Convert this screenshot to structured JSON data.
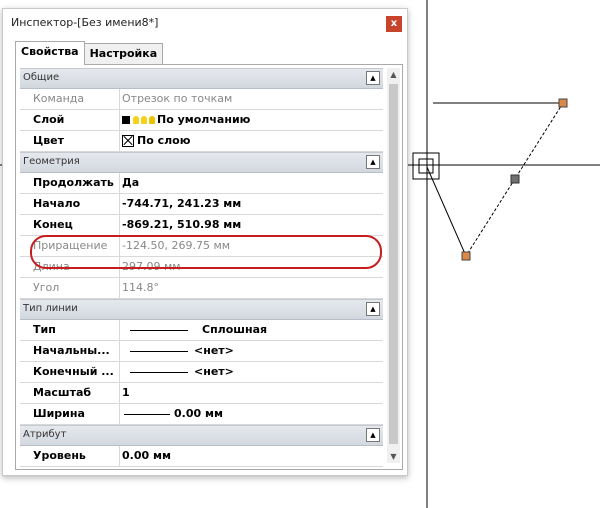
{
  "window": {
    "title": "Инспектор-[Без имени8*]",
    "close_symbol": "x"
  },
  "tabs": [
    {
      "label": "Свойства",
      "active": true
    },
    {
      "label": "Настройка",
      "active": false
    }
  ],
  "categories": {
    "general": "Общие",
    "geometry": "Геометрия",
    "linetype": "Тип линии",
    "attribute": "Атрибут"
  },
  "general_rows": {
    "command": {
      "name": "Команда",
      "value": "Отрезок по точкам"
    },
    "layer": {
      "name": "Слой",
      "value": "По умолчанию"
    },
    "color": {
      "name": "Цвет",
      "value": "По слою"
    }
  },
  "geometry_rows": {
    "continue": {
      "name": "Продолжать",
      "value": "Да"
    },
    "start": {
      "name": "Начало",
      "value": "-744.71, 241.23 мм"
    },
    "end": {
      "name": "Конец",
      "value": "-869.21, 510.98 мм"
    },
    "increment": {
      "name": "Приращение",
      "value": "-124.50, 269.75 мм"
    },
    "length": {
      "name": "Длина",
      "value": "297.09 мм"
    },
    "angle": {
      "name": "Угол",
      "value": "114.8°"
    }
  },
  "linetype_rows": {
    "type": {
      "name": "Тип",
      "value": "Сплошная"
    },
    "start_arrow": {
      "name": "Начальны...",
      "value": "<нет>"
    },
    "end_arrow": {
      "name": "Конечный ...",
      "value": "<нет>"
    },
    "scale": {
      "name": "Масштаб",
      "value": "1"
    },
    "width": {
      "name": "Ширина",
      "value": "0.00 мм"
    }
  },
  "attribute_rows": {
    "level": {
      "name": "Уровень",
      "value": "0.00 мм"
    }
  },
  "colors": {
    "highlight": "#c41e1e",
    "grip_orange": "#d98a4a",
    "grip_gray": "#707070",
    "close_button": "#c7432c"
  },
  "icons": [
    "close-icon",
    "collapse-icon",
    "bulb-icon",
    "layer-color-swatch-icon",
    "crossbox-icon",
    "scroll-up-icon",
    "scroll-down-icon"
  ]
}
